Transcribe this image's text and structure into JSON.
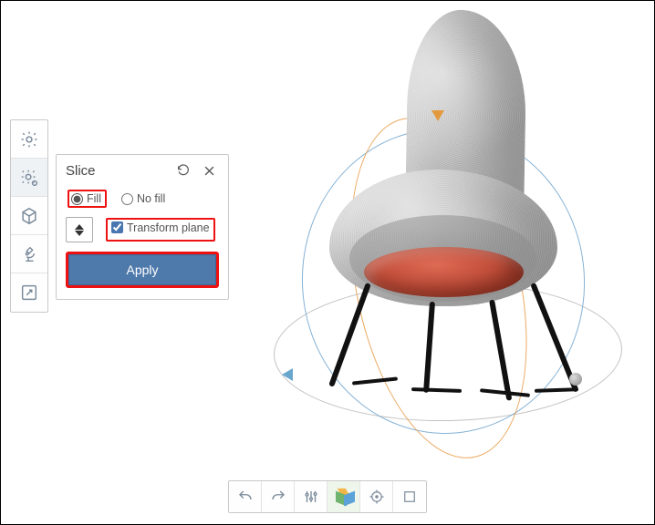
{
  "panel": {
    "title": "Slice",
    "fill_mode_selected": "fill",
    "options": {
      "fill_label": "Fill",
      "nofill_label": "No fill",
      "transform_plane_label": "Transform plane",
      "transform_plane_checked": true
    },
    "apply_label": "Apply"
  },
  "left_toolbar": {
    "items": [
      {
        "name": "settings-tool",
        "icon": "gear"
      },
      {
        "name": "slice-tool",
        "icon": "gear-badge",
        "active": true
      },
      {
        "name": "mesh-tool",
        "icon": "hexagon"
      },
      {
        "name": "inspect-tool",
        "icon": "microscope"
      },
      {
        "name": "export-tool",
        "icon": "popout"
      }
    ]
  },
  "bottom_toolbar": {
    "items": [
      {
        "name": "undo-button",
        "icon": "undo"
      },
      {
        "name": "redo-button",
        "icon": "redo"
      },
      {
        "name": "adjust-button",
        "icon": "sliders"
      },
      {
        "name": "view-cube-button",
        "icon": "cube",
        "active": true
      },
      {
        "name": "center-button",
        "icon": "target"
      },
      {
        "name": "crop-button",
        "icon": "crop"
      }
    ]
  },
  "scene": {
    "object": "chair-model",
    "gizmos": [
      "ground-orbit",
      "vertical-orbit",
      "tilt-orbit",
      "axis-handle"
    ]
  }
}
